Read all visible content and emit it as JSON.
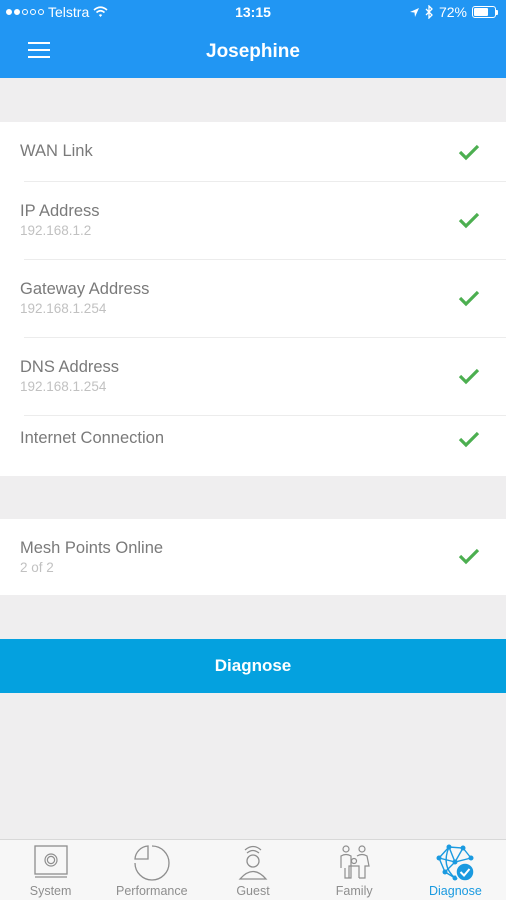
{
  "status_bar": {
    "carrier": "Telstra",
    "signal_bars_filled": 2,
    "signal_bars_total": 5,
    "time": "13:15",
    "battery_percent": "72%",
    "battery_level": 0.72
  },
  "header": {
    "title": "Josephine",
    "menu_icon": "hamburger-menu-icon"
  },
  "checks": [
    {
      "title": "WAN Link",
      "subtitle": "",
      "status": "ok"
    },
    {
      "title": "IP Address",
      "subtitle": "192.168.1.2",
      "status": "ok"
    },
    {
      "title": "Gateway Address",
      "subtitle": "192.168.1.254",
      "status": "ok"
    },
    {
      "title": "DNS Address",
      "subtitle": "192.168.1.254",
      "status": "ok"
    },
    {
      "title": "Internet Connection",
      "subtitle": "",
      "status": "ok"
    }
  ],
  "mesh": {
    "title": "Mesh Points Online",
    "subtitle": "2 of 2",
    "status": "ok"
  },
  "diagnose_button": "Diagnose",
  "colors": {
    "header": "#2196f3",
    "button": "#04a1df",
    "check": "#4caf50",
    "active_tab": "#1a9ae0"
  },
  "tabs": [
    {
      "label": "System",
      "icon": "system-icon",
      "active": false
    },
    {
      "label": "Performance",
      "icon": "performance-icon",
      "active": false
    },
    {
      "label": "Guest",
      "icon": "guest-icon",
      "active": false
    },
    {
      "label": "Family",
      "icon": "family-icon",
      "active": false
    },
    {
      "label": "Diagnose",
      "icon": "diagnose-icon",
      "active": true
    }
  ]
}
